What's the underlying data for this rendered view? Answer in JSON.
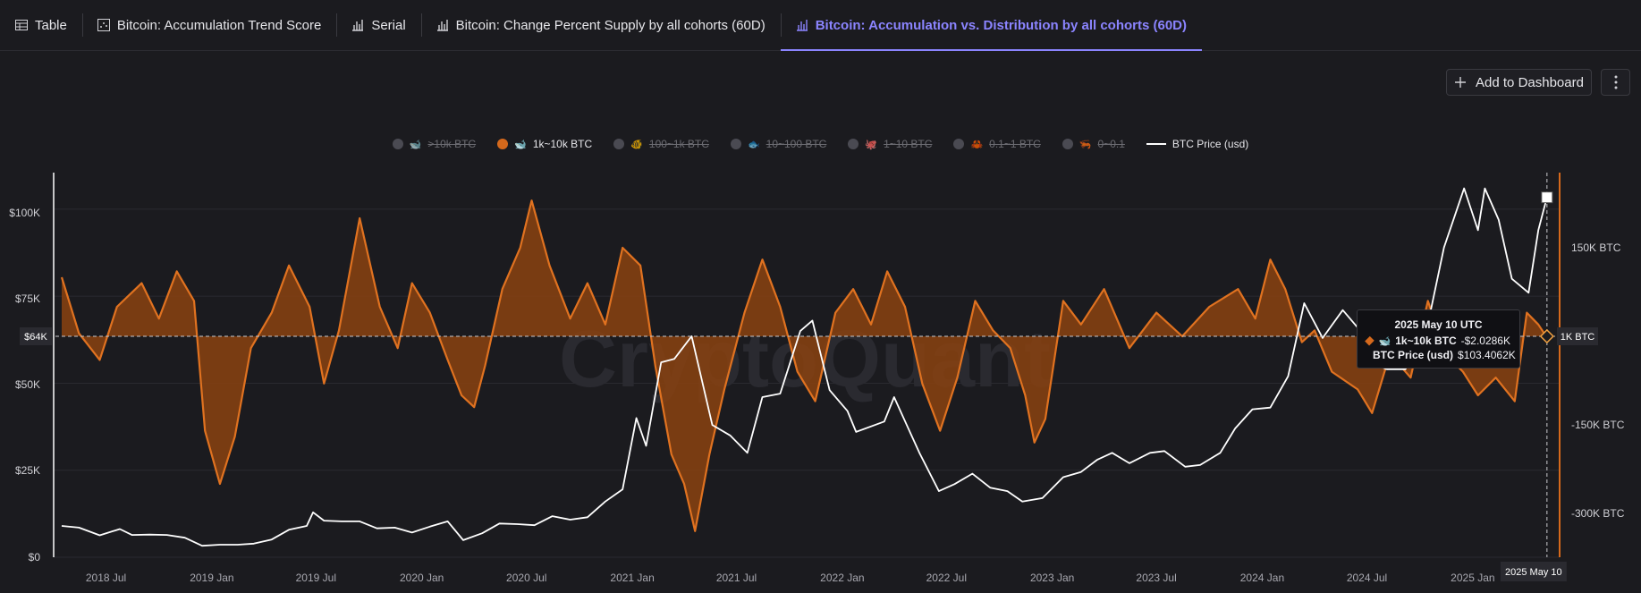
{
  "tabs": [
    {
      "label": "Table",
      "icon": "table-icon",
      "active": false
    },
    {
      "label": "Bitcoin: Accumulation Trend Score",
      "icon": "scatter-icon",
      "active": false
    },
    {
      "label": "Serial",
      "icon": "bar-chart-icon",
      "active": false
    },
    {
      "label": "Bitcoin: Change Percent Supply by all cohorts (60D)",
      "icon": "bar-chart-icon",
      "active": false
    },
    {
      "label": "Bitcoin: Accumulation vs. Distribution by all cohorts (60D)",
      "icon": "bar-chart-icon",
      "active": true
    }
  ],
  "toolbar": {
    "add_label": "Add to Dashboard"
  },
  "legend": [
    {
      "label": ">10k BTC",
      "color": "#1f8fd6",
      "enabled": false,
      "icon": "humpback-icon"
    },
    {
      "label": "1k~10k BTC",
      "color": "#d5691c",
      "enabled": true,
      "icon": "whale-icon"
    },
    {
      "label": "100~1k BTC",
      "color": "#2aa0e0",
      "enabled": false,
      "icon": "shark-icon"
    },
    {
      "label": "10~100 BTC",
      "color": "#2aa0e0",
      "enabled": false,
      "icon": "fish-icon"
    },
    {
      "label": "1~10 BTC",
      "color": "#e07a5a",
      "enabled": false,
      "icon": "octopus-icon"
    },
    {
      "label": "0.1~1 BTC",
      "color": "#e0484a",
      "enabled": false,
      "icon": "crab-icon"
    },
    {
      "label": "0~0.1",
      "color": "#e0484a",
      "enabled": false,
      "icon": "shrimp-icon"
    },
    {
      "label": "BTC Price (usd)",
      "color": "#ffffff",
      "enabled": true,
      "icon": "line-icon"
    }
  ],
  "tooltip": {
    "date": "2025 May 10 UTC",
    "rows": [
      {
        "label": "1k~10k BTC",
        "value": "-$2.0286K"
      },
      {
        "label": "BTC Price (usd)",
        "value": "$103.4062K"
      }
    ]
  },
  "chart_data": {
    "type": "line",
    "watermark": "CryptoQuant",
    "x_ticks": [
      "2018 Jul",
      "2019 Jan",
      "2019 Jul",
      "2020 Jan",
      "2020 Jul",
      "2021 Jan",
      "2021 Jul",
      "2022 Jan",
      "2022 Jul",
      "2023 Jan",
      "2023 Jul",
      "2024 Jan",
      "2024 Jul",
      "2025 Jan"
    ],
    "x_range": [
      "2018-04",
      "2025-06"
    ],
    "crosshair_x_label": "2025 May 10",
    "y_left": {
      "ticks": [
        "$0",
        "$25K",
        "$50K",
        "$75K",
        "$100K"
      ],
      "range": [
        0,
        110000
      ],
      "crosshair_label": "$64K"
    },
    "y_right": {
      "ticks": [
        "150K BTC",
        "-150K BTC",
        "-300K BTC"
      ],
      "range": [
        -375000,
        200000
      ],
      "crosshair_label": "1K BTC"
    },
    "series": [
      {
        "name": "1k~10k BTC",
        "axis": "right",
        "style": "area",
        "points": [
          [
            "2018-04-15",
            100000
          ],
          [
            "2018-05-15",
            5000
          ],
          [
            "2018-06-20",
            -40000
          ],
          [
            "2018-07-20",
            50000
          ],
          [
            "2018-09-01",
            90000
          ],
          [
            "2018-10-01",
            30000
          ],
          [
            "2018-11-01",
            110000
          ],
          [
            "2018-12-01",
            60000
          ],
          [
            "2018-12-20",
            -160000
          ],
          [
            "2019-01-15",
            -250000
          ],
          [
            "2019-02-10",
            -170000
          ],
          [
            "2019-03-10",
            -20000
          ],
          [
            "2019-04-15",
            40000
          ],
          [
            "2019-05-15",
            120000
          ],
          [
            "2019-06-20",
            50000
          ],
          [
            "2019-07-15",
            -80000
          ],
          [
            "2019-08-10",
            10000
          ],
          [
            "2019-09-15",
            200000
          ],
          [
            "2019-10-20",
            50000
          ],
          [
            "2019-11-20",
            -20000
          ],
          [
            "2019-12-15",
            90000
          ],
          [
            "2020-01-15",
            40000
          ],
          [
            "2020-02-15",
            -40000
          ],
          [
            "2020-03-10",
            -100000
          ],
          [
            "2020-04-01",
            -120000
          ],
          [
            "2020-04-20",
            -50000
          ],
          [
            "2020-05-20",
            80000
          ],
          [
            "2020-06-20",
            150000
          ],
          [
            "2020-07-10",
            230000
          ],
          [
            "2020-08-10",
            120000
          ],
          [
            "2020-09-15",
            30000
          ],
          [
            "2020-10-15",
            90000
          ],
          [
            "2020-11-15",
            20000
          ],
          [
            "2020-12-15",
            150000
          ],
          [
            "2021-01-15",
            120000
          ],
          [
            "2021-02-10",
            -50000
          ],
          [
            "2021-03-10",
            -200000
          ],
          [
            "2021-04-01",
            -250000
          ],
          [
            "2021-04-20",
            -330000
          ],
          [
            "2021-05-15",
            -200000
          ],
          [
            "2021-06-10",
            -90000
          ],
          [
            "2021-07-15",
            40000
          ],
          [
            "2021-08-15",
            130000
          ],
          [
            "2021-09-15",
            50000
          ],
          [
            "2021-10-15",
            -60000
          ],
          [
            "2021-11-15",
            -110000
          ],
          [
            "2021-12-20",
            40000
          ],
          [
            "2022-01-20",
            80000
          ],
          [
            "2022-02-20",
            20000
          ],
          [
            "2022-03-20",
            110000
          ],
          [
            "2022-04-20",
            50000
          ],
          [
            "2022-05-20",
            -80000
          ],
          [
            "2022-06-20",
            -160000
          ],
          [
            "2022-07-20",
            -70000
          ],
          [
            "2022-08-20",
            60000
          ],
          [
            "2022-09-20",
            10000
          ],
          [
            "2022-10-20",
            -20000
          ],
          [
            "2022-11-15",
            -100000
          ],
          [
            "2022-12-01",
            -180000
          ],
          [
            "2022-12-20",
            -140000
          ],
          [
            "2023-01-20",
            60000
          ],
          [
            "2023-02-20",
            20000
          ],
          [
            "2023-04-01",
            80000
          ],
          [
            "2023-05-15",
            -20000
          ],
          [
            "2023-07-01",
            40000
          ],
          [
            "2023-08-15",
            0
          ],
          [
            "2023-10-01",
            50000
          ],
          [
            "2023-11-20",
            80000
          ],
          [
            "2023-12-20",
            30000
          ],
          [
            "2024-01-15",
            130000
          ],
          [
            "2024-02-10",
            80000
          ],
          [
            "2024-03-10",
            -10000
          ],
          [
            "2024-04-01",
            10000
          ],
          [
            "2024-05-01",
            -60000
          ],
          [
            "2024-06-15",
            -90000
          ],
          [
            "2024-07-10",
            -130000
          ],
          [
            "2024-08-10",
            -30000
          ],
          [
            "2024-09-15",
            -70000
          ],
          [
            "2024-10-15",
            60000
          ],
          [
            "2024-11-15",
            -30000
          ],
          [
            "2024-12-15",
            -60000
          ],
          [
            "2025-01-10",
            -100000
          ],
          [
            "2025-02-10",
            -70000
          ],
          [
            "2025-03-15",
            -110000
          ],
          [
            "2025-04-05",
            40000
          ],
          [
            "2025-04-25",
            20000
          ],
          [
            "2025-05-10",
            -2029
          ]
        ]
      },
      {
        "name": "BTC Price (usd)",
        "axis": "left",
        "style": "line",
        "points": [
          [
            "2018-04-15",
            9000
          ],
          [
            "2018-05-15",
            8500
          ],
          [
            "2018-06-20",
            6300
          ],
          [
            "2018-07-25",
            8100
          ],
          [
            "2018-08-15",
            6400
          ],
          [
            "2018-09-15",
            6500
          ],
          [
            "2018-10-15",
            6400
          ],
          [
            "2018-11-15",
            5600
          ],
          [
            "2018-12-15",
            3300
          ],
          [
            "2019-01-15",
            3600
          ],
          [
            "2019-02-15",
            3600
          ],
          [
            "2019-03-15",
            3900
          ],
          [
            "2019-04-15",
            5100
          ],
          [
            "2019-05-15",
            7900
          ],
          [
            "2019-06-15",
            9000
          ],
          [
            "2019-06-26",
            12900
          ],
          [
            "2019-07-15",
            10500
          ],
          [
            "2019-08-15",
            10300
          ],
          [
            "2019-09-15",
            10300
          ],
          [
            "2019-10-15",
            8300
          ],
          [
            "2019-11-15",
            8500
          ],
          [
            "2019-12-15",
            7100
          ],
          [
            "2020-01-15",
            8800
          ],
          [
            "2020-02-15",
            10300
          ],
          [
            "2020-03-13",
            4900
          ],
          [
            "2020-04-15",
            6900
          ],
          [
            "2020-05-15",
            9700
          ],
          [
            "2020-06-15",
            9500
          ],
          [
            "2020-07-15",
            9200
          ],
          [
            "2020-08-15",
            11800
          ],
          [
            "2020-09-15",
            10800
          ],
          [
            "2020-10-15",
            11500
          ],
          [
            "2020-11-15",
            16000
          ],
          [
            "2020-12-15",
            19500
          ],
          [
            "2021-01-08",
            40000
          ],
          [
            "2021-01-25",
            32000
          ],
          [
            "2021-02-20",
            56000
          ],
          [
            "2021-03-15",
            57000
          ],
          [
            "2021-04-14",
            63500
          ],
          [
            "2021-05-20",
            38000
          ],
          [
            "2021-06-20",
            35000
          ],
          [
            "2021-07-20",
            30000
          ],
          [
            "2021-08-15",
            46000
          ],
          [
            "2021-09-15",
            47000
          ],
          [
            "2021-10-20",
            65000
          ],
          [
            "2021-11-10",
            68000
          ],
          [
            "2021-12-10",
            48000
          ],
          [
            "2022-01-10",
            42000
          ],
          [
            "2022-01-25",
            36000
          ],
          [
            "2022-03-15",
            39000
          ],
          [
            "2022-04-01",
            46000
          ],
          [
            "2022-05-15",
            30000
          ],
          [
            "2022-06-18",
            19000
          ],
          [
            "2022-07-15",
            21000
          ],
          [
            "2022-08-15",
            24000
          ],
          [
            "2022-09-15",
            20000
          ],
          [
            "2022-10-15",
            19000
          ],
          [
            "2022-11-10",
            16000
          ],
          [
            "2022-12-15",
            17000
          ],
          [
            "2023-01-20",
            23000
          ],
          [
            "2023-02-20",
            24500
          ],
          [
            "2023-03-20",
            28000
          ],
          [
            "2023-04-15",
            30000
          ],
          [
            "2023-05-15",
            27000
          ],
          [
            "2023-06-20",
            30000
          ],
          [
            "2023-07-15",
            30500
          ],
          [
            "2023-08-20",
            26000
          ],
          [
            "2023-09-15",
            26500
          ],
          [
            "2023-10-20",
            30000
          ],
          [
            "2023-11-15",
            37000
          ],
          [
            "2023-12-15",
            42500
          ],
          [
            "2024-01-15",
            43000
          ],
          [
            "2024-02-15",
            52000
          ],
          [
            "2024-03-14",
            73000
          ],
          [
            "2024-04-15",
            63000
          ],
          [
            "2024-05-20",
            71000
          ],
          [
            "2024-06-20",
            65000
          ],
          [
            "2024-07-05",
            56000
          ],
          [
            "2024-08-05",
            54000
          ],
          [
            "2024-09-06",
            54000
          ],
          [
            "2024-10-15",
            67000
          ],
          [
            "2024-11-12",
            89000
          ],
          [
            "2024-12-17",
            106000
          ],
          [
            "2025-01-10",
            94000
          ],
          [
            "2025-01-22",
            106000
          ],
          [
            "2025-02-15",
            97000
          ],
          [
            "2025-03-10",
            80000
          ],
          [
            "2025-04-08",
            76000
          ],
          [
            "2025-04-25",
            94000
          ],
          [
            "2025-05-10",
            103406
          ]
        ]
      }
    ]
  }
}
